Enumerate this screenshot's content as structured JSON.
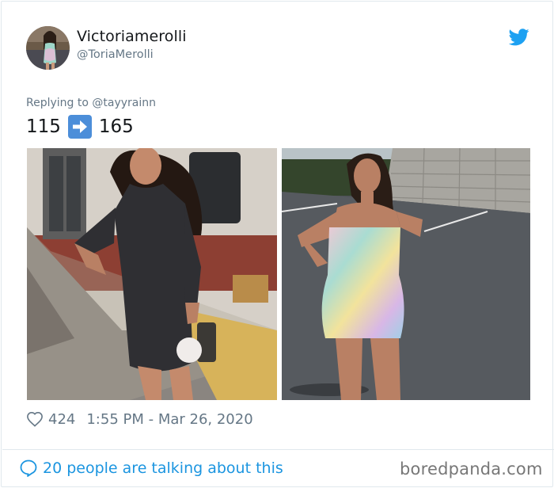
{
  "tweet": {
    "display_name": "Victoriamerolli",
    "handle": "@ToriaMerolli",
    "replying_to": "Replying to @tayyrainn",
    "text_before": "115",
    "arrow": "right-arrow-icon",
    "text_after": "165",
    "likes": "424",
    "timestamp": "1:55 PM - Mar 26, 2020",
    "conversation": "20 people are talking about this"
  },
  "icons": {
    "brand": "twitter-bird-icon",
    "like": "heart-icon",
    "reply": "speech-bubble-icon"
  },
  "watermark": "boredpanda.com",
  "colors": {
    "twitter_blue": "#1da1f2",
    "link_blue": "#1b95e0",
    "muted_text": "#657786",
    "arrow_emoji_blue": "#4c8ed9"
  }
}
